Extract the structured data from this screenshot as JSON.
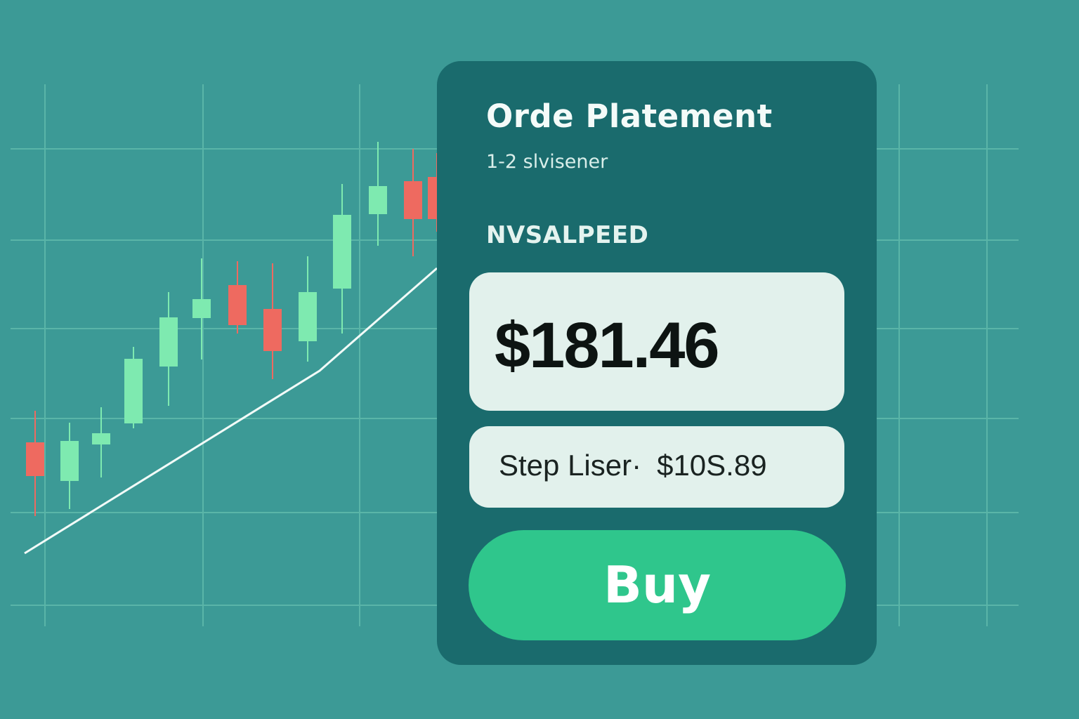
{
  "colors": {
    "background": "#3c9a96",
    "panel": "#1a6b6d",
    "field": "#e2f1ec",
    "buy": "#2fc68c",
    "candle_up": "#7eeab0",
    "candle_down": "#ee6a60",
    "grid": "#5ab5a8",
    "trend_line": "#f2fbf8"
  },
  "order_panel": {
    "title": "Orde Platement",
    "subtitle": "1-2 slvisener",
    "symbol": "NVSALPEED",
    "price": "$181.46",
    "stop_label": "Step Liser·",
    "stop_value": "$10S.89",
    "buy_label": "Buy"
  }
}
